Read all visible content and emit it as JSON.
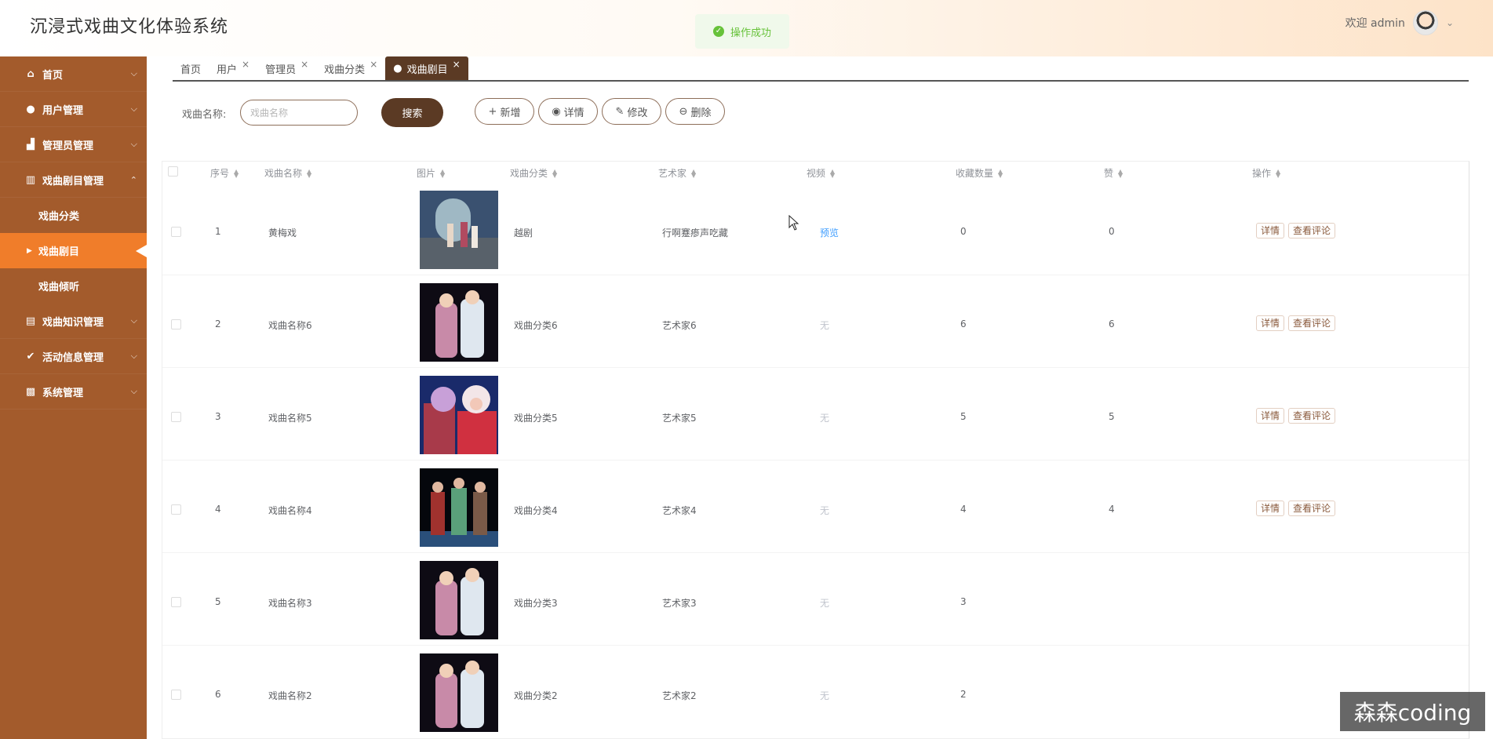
{
  "app": {
    "title": "沉浸式戏曲文化体验系统",
    "toast": "操作成功",
    "welcome": "欢迎 admin"
  },
  "sidebar": {
    "items": [
      {
        "label": "首页",
        "icon": "home-icon"
      },
      {
        "label": "用户管理",
        "icon": "user-icon"
      },
      {
        "label": "管理员管理",
        "icon": "admin-icon"
      },
      {
        "label": "戏曲剧目管理",
        "icon": "book-icon"
      },
      {
        "label": "戏曲知识管理",
        "icon": "doc-icon"
      },
      {
        "label": "活动信息管理",
        "icon": "check-icon"
      },
      {
        "label": "系统管理",
        "icon": "chart-icon"
      }
    ],
    "submenu": [
      "戏曲分类",
      "戏曲剧目",
      "戏曲倾听"
    ]
  },
  "tabs": [
    "首页",
    "用户",
    "管理员",
    "戏曲分类",
    "戏曲剧目"
  ],
  "search": {
    "label": "戏曲名称:",
    "placeholder": "戏曲名称",
    "button": "搜索"
  },
  "toolbar": {
    "add": "新增",
    "detail": "详情",
    "edit": "修改",
    "delete": "删除"
  },
  "table": {
    "headers": [
      "序号",
      "戏曲名称",
      "图片",
      "戏曲分类",
      "艺术家",
      "视频",
      "收藏数量",
      "赞",
      "操作"
    ],
    "rows": [
      {
        "no": "1",
        "name": "黄梅戏",
        "category": "越剧",
        "artist": "行啊蹇瘆声吃藏",
        "video": "预览",
        "fav": "0",
        "like": "0"
      },
      {
        "no": "2",
        "name": "戏曲名称6",
        "category": "戏曲分类6",
        "artist": "艺术家6",
        "video": "无",
        "fav": "6",
        "like": "6"
      },
      {
        "no": "3",
        "name": "戏曲名称5",
        "category": "戏曲分类5",
        "artist": "艺术家5",
        "video": "无",
        "fav": "5",
        "like": "5"
      },
      {
        "no": "4",
        "name": "戏曲名称4",
        "category": "戏曲分类4",
        "artist": "艺术家4",
        "video": "无",
        "fav": "4",
        "like": "4"
      },
      {
        "no": "5",
        "name": "戏曲名称3",
        "category": "戏曲分类3",
        "artist": "艺术家3",
        "video": "无",
        "fav": "3",
        "like": ""
      },
      {
        "no": "6",
        "name": "戏曲名称2",
        "category": "戏曲分类2",
        "artist": "艺术家2",
        "video": "无",
        "fav": "2",
        "like": ""
      }
    ],
    "ops": [
      "详情",
      "查看评论"
    ]
  },
  "watermark": "森森coding"
}
